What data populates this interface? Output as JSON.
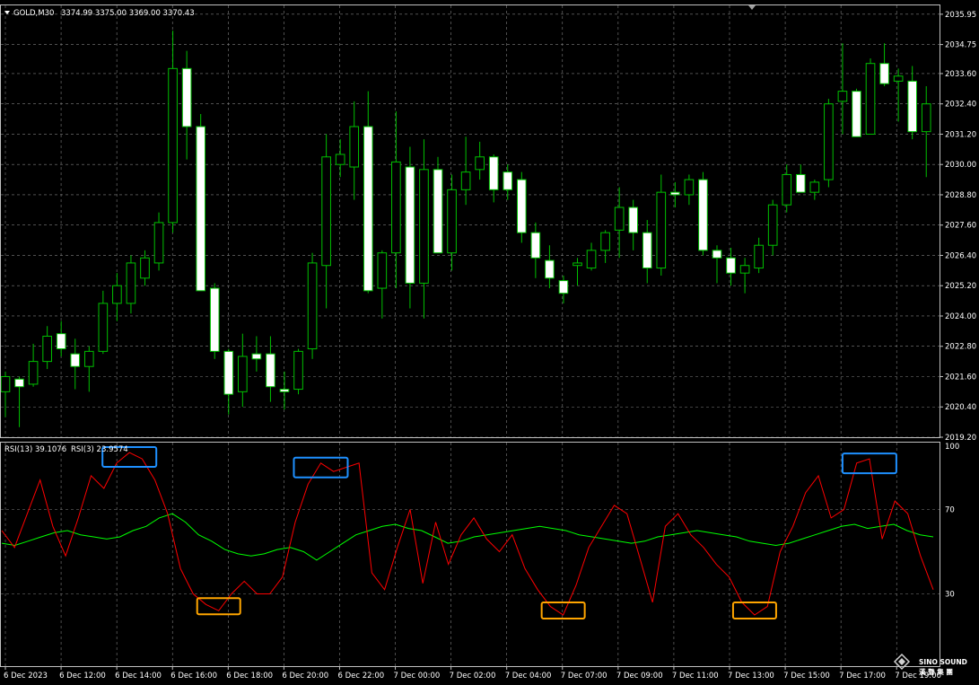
{
  "header": {
    "symbol_label": "GOLD,M30",
    "ohlc_label": "3374.99 3375.00 3369.00 3370.43"
  },
  "rsi_header": {
    "rsi13_label": "RSI(13) 39.1076",
    "rsi3_label": "RSI(3) 23.9574"
  },
  "watermark": {
    "brand": "SINO SOUND",
    "sub": "漢 聲 集 團"
  },
  "colors": {
    "background": "#000000",
    "bull_candle": "#00c000",
    "bear_candle_fill": "#ffffff",
    "wick": "#00c000",
    "grid": "#808080",
    "rsi13": "#00ff00",
    "rsi3": "#ff0000",
    "overbought_box": "#1e90ff",
    "oversold_box": "#ffa500"
  },
  "chart_data": [
    {
      "type": "candlestick",
      "title": "GOLD,M30",
      "price_axis_labels": [
        "2035.95",
        "2034.75",
        "2033.60",
        "2032.40",
        "2031.20",
        "2030.00",
        "2028.80",
        "2027.60",
        "2026.40",
        "2025.20",
        "2024.00",
        "2022.80",
        "2021.60",
        "2020.40",
        "2019.20"
      ],
      "ylim": [
        2019.2,
        2036.3
      ],
      "time_axis_labels": [
        "6 Dec 2023",
        "6 Dec 12:00",
        "6 Dec 14:00",
        "6 Dec 16:00",
        "6 Dec 18:00",
        "6 Dec 20:00",
        "6 Dec 22:00",
        "7 Dec 00:00",
        "7 Dec 02:00",
        "7 Dec 04:00",
        "7 Dec 07:00",
        "7 Dec 09:00",
        "7 Dec 11:00",
        "7 Dec 13:00",
        "7 Dec 15:00",
        "7 Dec 17:00",
        "7 Dec 19:00"
      ],
      "candles": [
        {
          "o": 2021.0,
          "h": 2021.8,
          "l": 2020.0,
          "c": 2021.6
        },
        {
          "o": 2021.5,
          "h": 2021.6,
          "l": 2019.6,
          "c": 2021.2
        },
        {
          "o": 2021.3,
          "h": 2022.9,
          "l": 2021.2,
          "c": 2022.2
        },
        {
          "o": 2022.2,
          "h": 2023.6,
          "l": 2021.9,
          "c": 2023.2
        },
        {
          "o": 2023.3,
          "h": 2023.8,
          "l": 2022.4,
          "c": 2022.7
        },
        {
          "o": 2022.5,
          "h": 2023.1,
          "l": 2021.1,
          "c": 2022.0
        },
        {
          "o": 2022.0,
          "h": 2022.8,
          "l": 2021.0,
          "c": 2022.6
        },
        {
          "o": 2022.6,
          "h": 2025.0,
          "l": 2022.5,
          "c": 2024.5
        },
        {
          "o": 2024.5,
          "h": 2025.7,
          "l": 2023.8,
          "c": 2025.2
        },
        {
          "o": 2024.5,
          "h": 2026.4,
          "l": 2024.1,
          "c": 2026.1
        },
        {
          "o": 2025.5,
          "h": 2026.6,
          "l": 2025.2,
          "c": 2026.3
        },
        {
          "o": 2026.1,
          "h": 2028.1,
          "l": 2025.8,
          "c": 2027.7
        },
        {
          "o": 2027.7,
          "h": 2035.3,
          "l": 2027.3,
          "c": 2033.8
        },
        {
          "o": 2033.8,
          "h": 2034.5,
          "l": 2030.2,
          "c": 2031.5
        },
        {
          "o": 2031.5,
          "h": 2032.0,
          "l": 2025.0,
          "c": 2025.0
        },
        {
          "o": 2025.1,
          "h": 2025.3,
          "l": 2022.3,
          "c": 2022.6
        },
        {
          "o": 2022.6,
          "h": 2022.7,
          "l": 2020.1,
          "c": 2020.9
        },
        {
          "o": 2021.0,
          "h": 2023.3,
          "l": 2020.4,
          "c": 2022.4
        },
        {
          "o": 2022.5,
          "h": 2023.2,
          "l": 2021.8,
          "c": 2022.3
        },
        {
          "o": 2022.5,
          "h": 2023.2,
          "l": 2020.6,
          "c": 2021.2
        },
        {
          "o": 2021.1,
          "h": 2021.8,
          "l": 2020.3,
          "c": 2021.0
        },
        {
          "o": 2021.1,
          "h": 2022.7,
          "l": 2020.9,
          "c": 2022.6
        },
        {
          "o": 2022.7,
          "h": 2026.5,
          "l": 2022.3,
          "c": 2026.1
        },
        {
          "o": 2026.0,
          "h": 2031.2,
          "l": 2024.3,
          "c": 2030.3
        },
        {
          "o": 2030.0,
          "h": 2031.0,
          "l": 2029.5,
          "c": 2030.4
        },
        {
          "o": 2029.9,
          "h": 2032.5,
          "l": 2028.6,
          "c": 2031.5
        },
        {
          "o": 2031.5,
          "h": 2032.9,
          "l": 2024.9,
          "c": 2025.0
        },
        {
          "o": 2025.1,
          "h": 2026.6,
          "l": 2023.9,
          "c": 2026.5
        },
        {
          "o": 2026.5,
          "h": 2032.1,
          "l": 2025.1,
          "c": 2030.1
        },
        {
          "o": 2029.9,
          "h": 2030.7,
          "l": 2024.3,
          "c": 2025.3
        },
        {
          "o": 2025.3,
          "h": 2031.0,
          "l": 2023.9,
          "c": 2029.8
        },
        {
          "o": 2029.8,
          "h": 2030.3,
          "l": 2026.5,
          "c": 2026.5
        },
        {
          "o": 2026.5,
          "h": 2029.6,
          "l": 2025.8,
          "c": 2029.0
        },
        {
          "o": 2029.0,
          "h": 2031.1,
          "l": 2028.4,
          "c": 2029.7
        },
        {
          "o": 2029.8,
          "h": 2030.9,
          "l": 2029.4,
          "c": 2030.3
        },
        {
          "o": 2030.3,
          "h": 2030.4,
          "l": 2028.5,
          "c": 2029.0
        },
        {
          "o": 2029.7,
          "h": 2030.0,
          "l": 2028.6,
          "c": 2029.0
        },
        {
          "o": 2029.4,
          "h": 2029.7,
          "l": 2026.9,
          "c": 2027.3
        },
        {
          "o": 2027.3,
          "h": 2027.7,
          "l": 2025.5,
          "c": 2026.3
        },
        {
          "o": 2026.2,
          "h": 2026.8,
          "l": 2025.1,
          "c": 2025.5
        },
        {
          "o": 2025.4,
          "h": 2025.6,
          "l": 2024.5,
          "c": 2024.9
        },
        {
          "o": 2026.0,
          "h": 2026.3,
          "l": 2025.2,
          "c": 2026.1
        },
        {
          "o": 2025.9,
          "h": 2026.9,
          "l": 2025.8,
          "c": 2026.6
        },
        {
          "o": 2026.6,
          "h": 2027.4,
          "l": 2026.1,
          "c": 2027.3
        },
        {
          "o": 2027.4,
          "h": 2029.1,
          "l": 2026.3,
          "c": 2028.3
        },
        {
          "o": 2028.3,
          "h": 2028.6,
          "l": 2026.6,
          "c": 2027.3
        },
        {
          "o": 2027.3,
          "h": 2027.8,
          "l": 2025.3,
          "c": 2025.9
        },
        {
          "o": 2025.9,
          "h": 2029.6,
          "l": 2025.6,
          "c": 2028.9
        },
        {
          "o": 2028.9,
          "h": 2029.3,
          "l": 2028.3,
          "c": 2028.8
        },
        {
          "o": 2028.8,
          "h": 2029.6,
          "l": 2028.4,
          "c": 2029.4
        },
        {
          "o": 2029.4,
          "h": 2029.7,
          "l": 2026.4,
          "c": 2026.6
        },
        {
          "o": 2026.6,
          "h": 2026.8,
          "l": 2025.3,
          "c": 2026.3
        },
        {
          "o": 2026.3,
          "h": 2026.7,
          "l": 2025.2,
          "c": 2025.7
        },
        {
          "o": 2025.7,
          "h": 2026.3,
          "l": 2024.9,
          "c": 2026.0
        },
        {
          "o": 2025.9,
          "h": 2027.1,
          "l": 2025.7,
          "c": 2026.8
        },
        {
          "o": 2026.8,
          "h": 2028.6,
          "l": 2026.4,
          "c": 2028.4
        },
        {
          "o": 2028.4,
          "h": 2030.0,
          "l": 2028.1,
          "c": 2029.6
        },
        {
          "o": 2029.6,
          "h": 2030.0,
          "l": 2028.9,
          "c": 2028.9
        },
        {
          "o": 2028.9,
          "h": 2029.4,
          "l": 2028.6,
          "c": 2029.3
        },
        {
          "o": 2029.4,
          "h": 2032.6,
          "l": 2029.1,
          "c": 2032.4
        },
        {
          "o": 2032.5,
          "h": 2034.8,
          "l": 2031.2,
          "c": 2032.9
        },
        {
          "o": 2032.9,
          "h": 2033.0,
          "l": 2031.1,
          "c": 2031.1
        },
        {
          "o": 2031.2,
          "h": 2034.2,
          "l": 2031.2,
          "c": 2034.0
        },
        {
          "o": 2034.0,
          "h": 2034.8,
          "l": 2033.1,
          "c": 2033.2
        },
        {
          "o": 2033.3,
          "h": 2033.8,
          "l": 2031.7,
          "c": 2033.5
        },
        {
          "o": 2033.3,
          "h": 2033.9,
          "l": 2031.0,
          "c": 2031.3
        },
        {
          "o": 2031.3,
          "h": 2033.1,
          "l": 2029.5,
          "c": 2032.4
        }
      ]
    },
    {
      "type": "line",
      "title": "RSI",
      "ylim": [
        0,
        100
      ],
      "levels": [
        100,
        70,
        30
      ],
      "level_labels": [
        "100",
        "70",
        "30"
      ],
      "series": [
        {
          "name": "RSI(13)",
          "values": [
            54,
            53,
            55,
            57,
            59,
            60,
            58,
            57,
            56,
            57,
            60,
            62,
            66,
            68,
            64,
            58,
            55,
            51,
            49,
            48,
            49,
            51,
            52,
            50,
            46,
            50,
            54,
            58,
            60,
            62,
            63,
            61,
            60,
            57,
            54,
            55,
            57,
            58,
            59,
            60,
            61,
            62,
            61,
            60,
            58,
            57,
            56,
            55,
            54,
            55,
            57,
            58,
            59,
            60,
            59,
            58,
            57,
            55,
            54,
            53,
            54,
            56,
            58,
            60,
            62,
            63,
            61,
            62,
            63,
            60,
            58,
            57
          ]
        },
        {
          "name": "RSI(3)",
          "values": [
            60,
            52,
            68,
            84,
            62,
            48,
            66,
            86,
            80,
            92,
            97,
            94,
            84,
            68,
            42,
            30,
            25,
            22,
            30,
            36,
            30,
            30,
            38,
            64,
            82,
            92,
            88,
            90,
            92,
            40,
            32,
            52,
            70,
            35,
            64,
            44,
            58,
            66,
            56,
            50,
            58,
            42,
            32,
            24,
            20,
            34,
            52,
            62,
            72,
            68,
            47,
            26,
            62,
            68,
            58,
            52,
            44,
            38,
            26,
            20,
            24,
            50,
            62,
            78,
            86,
            66,
            70,
            92,
            94,
            56,
            74,
            68,
            48,
            32
          ]
        }
      ],
      "overbought_highlights": 3,
      "oversold_highlights": 3
    }
  ]
}
